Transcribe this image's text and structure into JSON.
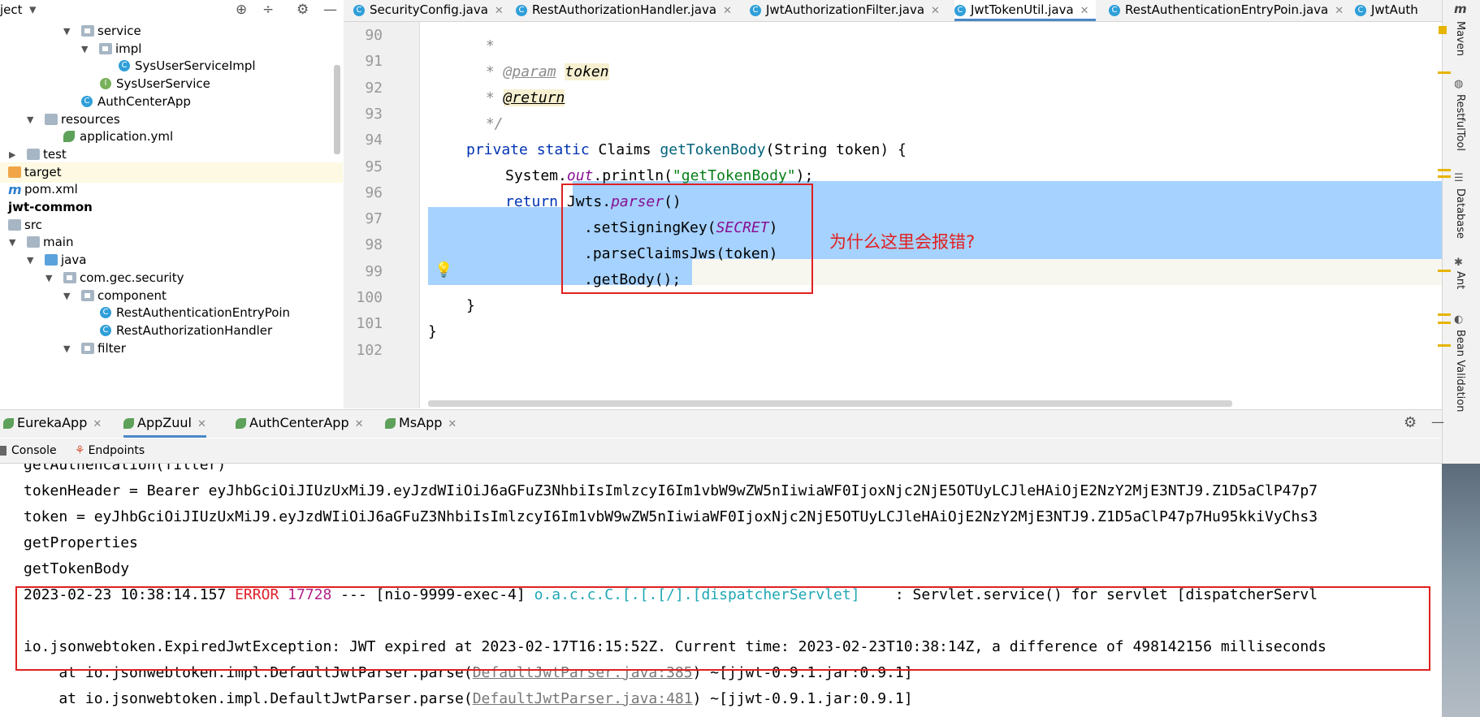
{
  "project": {
    "header_label": "ject",
    "tree": [
      {
        "label": "service",
        "indent": 100,
        "kind": "pkg"
      },
      {
        "label": "impl",
        "indent": 122,
        "kind": "pkg"
      },
      {
        "label": "SysUserServiceImpl",
        "indent": 146,
        "kind": "class"
      },
      {
        "label": "SysUserService",
        "indent": 123,
        "kind": "interface"
      },
      {
        "label": "AuthCenterApp",
        "indent": 100,
        "kind": "class"
      },
      {
        "label": "resources",
        "indent": 55,
        "kind": "res"
      },
      {
        "label": "application.yml",
        "indent": 78,
        "kind": "yml"
      },
      {
        "label": "test",
        "indent": 33,
        "kind": "folder"
      },
      {
        "label": "target",
        "indent": 10,
        "kind": "orange"
      },
      {
        "label": "pom.xml",
        "indent": 10,
        "kind": "maven"
      },
      {
        "label": "jwt-common",
        "indent": 10,
        "kind": "module"
      },
      {
        "label": "src",
        "indent": 10,
        "kind": "folder"
      },
      {
        "label": "main",
        "indent": 33,
        "kind": "folder"
      },
      {
        "label": "java",
        "indent": 55,
        "kind": "blue"
      },
      {
        "label": "com.gec.security",
        "indent": 78,
        "kind": "pkg"
      },
      {
        "label": "component",
        "indent": 100,
        "kind": "pkg"
      },
      {
        "label": "RestAuthenticationEntryPoin",
        "indent": 123,
        "kind": "class"
      },
      {
        "label": "RestAuthorizationHandler",
        "indent": 123,
        "kind": "class"
      },
      {
        "label": "filter",
        "indent": 100,
        "kind": "pkg"
      }
    ]
  },
  "tabs": [
    {
      "label": "SecurityConfig.java"
    },
    {
      "label": "RestAuthorizationHandler.java"
    },
    {
      "label": "JwtAuthorizationFilter.java"
    },
    {
      "label": "JwtTokenUtil.java",
      "active": true
    },
    {
      "label": "RestAuthenticationEntryPoin.java"
    },
    {
      "label": "JwtAuth"
    }
  ],
  "editor": {
    "line_numbers": [
      "90",
      "91",
      "92",
      "93",
      "94",
      "95",
      "96",
      "97",
      "98",
      "99",
      "100",
      "101",
      "102"
    ],
    "line90": " *",
    "line91_star": " * ",
    "line91_tag": "@param",
    "line91_name": "token",
    "line92_star": " * ",
    "line92_tag": "@return",
    "line93": " */",
    "line94_kw": "private static",
    "line94_type": " Claims ",
    "line94_fn": "getTokenBody",
    "line94_rest": "(String token) {",
    "line95_a": "System.",
    "line95_out": "out",
    "line95_b": ".println(",
    "line95_str": "\"getTokenBody\"",
    "line95_c": ");",
    "line96_kw": "return",
    "line96_a": " Jwts.",
    "line96_parser": "parser",
    "line96_b": "()",
    "line97_a": ".setSigningKey(",
    "line97_const": "SECRET",
    "line97_b": ")",
    "line98": ".parseClaimsJws(token)",
    "line99": ".getBody();",
    "line100": "}",
    "line101": "}",
    "annotation": "为什么这里会报错?"
  },
  "right_tools": [
    "Maven",
    "RestfulTool",
    "Database",
    "Ant",
    "Bean Validation"
  ],
  "run_tabs": [
    {
      "label": "EurekaApp"
    },
    {
      "label": "AppZuul",
      "active": true
    },
    {
      "label": "AuthCenterApp"
    },
    {
      "label": "MsApp"
    }
  ],
  "sub_tabs": [
    "Console",
    "Endpoints"
  ],
  "console": {
    "l0": "getAuthencation(filter)",
    "l1": "tokenHeader = Bearer eyJhbGciOiJIUzUxMiJ9.eyJzdWIiOiJ6aGFuZ3NhbiIsImlzcyI6Im1vbW9wZW5nIiwiaWF0IjoxNjc2NjE5OTUyLCJleHAiOjE2NzY2MjE3NTJ9.Z1D5aClP47p7",
    "l2": "token = eyJhbGciOiJIUzUxMiJ9.eyJzdWIiOiJ6aGFuZ3NhbiIsImlzcyI6Im1vbW9wZW5nIiwiaWF0IjoxNjc2NjE5OTUyLCJleHAiOjE2NzY2MjE3NTJ9.Z1D5aClP47p7Hu95kkiVyChs3",
    "l3": "getProperties",
    "l4": "getTokenBody",
    "l5_ts": "2023-02-23 10:38:14.157 ",
    "l5_level": "ERROR",
    "l5_pid": " 17728",
    "l5_thread": " --- [nio-9999-exec-4] ",
    "l5_logger": "o.a.c.c.C.[.[.[/].[dispatcherServlet]",
    "l5_msg": "    : Servlet.service() for servlet [dispatcherServl",
    "l7": "io.jsonwebtoken.ExpiredJwtException: JWT expired at 2023-02-17T16:15:52Z. Current time: 2023-02-23T10:38:14Z, a difference of 498142156 milliseconds",
    "l8_a": "    at io.jsonwebtoken.impl.DefaultJwtParser.parse(",
    "l8_link": "DefaultJwtParser.java:385",
    "l8_b": ") ~[jjwt-0.9.1.jar:0.9.1]",
    "l9_a": "    at io.jsonwebtoken.impl.DefaultJwtParser.parse(",
    "l9_link": "DefaultJwtParser.java:481",
    "l9_b": ") ~[jjwt-0.9.1.jar:0.9.1]"
  }
}
